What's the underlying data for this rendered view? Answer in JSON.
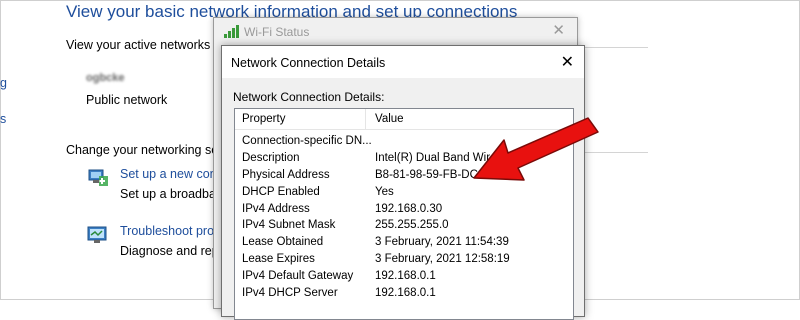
{
  "background": {
    "heading": "View your basic network information and set up connections",
    "active_networks_label": "View your active networks",
    "network_name": "ogbcke",
    "network_type": "Public network",
    "change_settings_label": "Change your networking se",
    "setup_link": "Set up a new con",
    "setup_desc": "Set up a broadbar",
    "troubleshoot_link": "Troubleshoot prob",
    "troubleshoot_desc": "Diagnose and repa",
    "left_nav": [
      "g",
      "s"
    ]
  },
  "wifi_window": {
    "title": "Wi-Fi Status",
    "close": "✕"
  },
  "details_window": {
    "title": "Network Connection Details",
    "close": "✕",
    "label": "Network Connection Details:",
    "columns": [
      "Property",
      "Value"
    ],
    "rows": [
      {
        "property": "Connection-specific DN...",
        "value": ""
      },
      {
        "property": "Description",
        "value": "Intel(R) Dual Band Wirele          165"
      },
      {
        "property": "Physical Address",
        "value": "B8-81-98-59-FB-DC"
      },
      {
        "property": "DHCP Enabled",
        "value": "Yes"
      },
      {
        "property": "IPv4 Address",
        "value": "192.168.0.30"
      },
      {
        "property": "IPv4 Subnet Mask",
        "value": "255.255.255.0"
      },
      {
        "property": "Lease Obtained",
        "value": "3 February, 2021 11:54:39"
      },
      {
        "property": "Lease Expires",
        "value": "3 February, 2021 12:58:19"
      },
      {
        "property": "IPv4 Default Gateway",
        "value": "192.168.0.1"
      },
      {
        "property": "IPv4 DHCP Server",
        "value": "192.168.0.1"
      }
    ]
  },
  "annotation": {
    "arrow_color": "#e8110f"
  }
}
